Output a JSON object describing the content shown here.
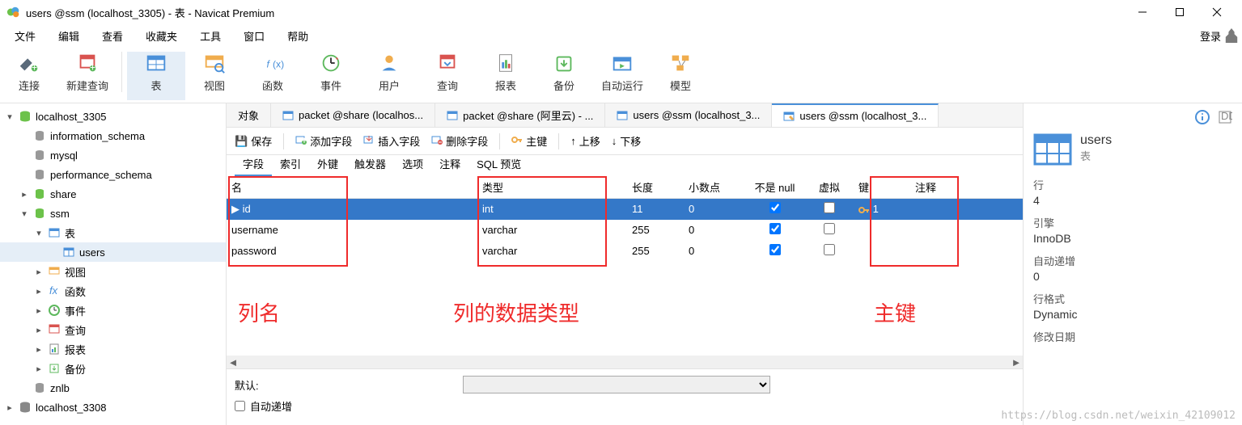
{
  "window": {
    "title": "users @ssm (localhost_3305) - 表 - Navicat Premium"
  },
  "menu": {
    "items": [
      "文件",
      "编辑",
      "查看",
      "收藏夹",
      "工具",
      "窗口",
      "帮助"
    ],
    "login": "登录"
  },
  "toolbar": {
    "connection": "连接",
    "new_query": "新建查询",
    "table": "表",
    "view": "视图",
    "function": "函数",
    "event": "事件",
    "user": "用户",
    "query": "查询",
    "report": "报表",
    "backup": "备份",
    "automation": "自动运行",
    "model": "模型"
  },
  "sidebar": {
    "items": [
      {
        "label": "localhost_3305",
        "type": "conn",
        "indent": 0,
        "expanded": true,
        "caret": true
      },
      {
        "label": "information_schema",
        "type": "db",
        "indent": 1,
        "caret": false
      },
      {
        "label": "mysql",
        "type": "db",
        "indent": 1,
        "caret": false
      },
      {
        "label": "performance_schema",
        "type": "db",
        "indent": 1,
        "caret": false
      },
      {
        "label": "share",
        "type": "db-open",
        "indent": 1,
        "caret": true,
        "expanded": false
      },
      {
        "label": "ssm",
        "type": "db-open",
        "indent": 1,
        "caret": true,
        "expanded": true
      },
      {
        "label": "表",
        "type": "folder-table",
        "indent": 2,
        "caret": true,
        "expanded": true
      },
      {
        "label": "users",
        "type": "table",
        "indent": 3,
        "caret": false,
        "selected": true
      },
      {
        "label": "视图",
        "type": "folder-view",
        "indent": 2,
        "caret": true
      },
      {
        "label": "函数",
        "type": "folder-fx",
        "indent": 2,
        "caret": true
      },
      {
        "label": "事件",
        "type": "folder-event",
        "indent": 2,
        "caret": true
      },
      {
        "label": "查询",
        "type": "folder-query",
        "indent": 2,
        "caret": true
      },
      {
        "label": "报表",
        "type": "folder-report",
        "indent": 2,
        "caret": true
      },
      {
        "label": "备份",
        "type": "folder-backup",
        "indent": 2,
        "caret": true
      },
      {
        "label": "znlb",
        "type": "db",
        "indent": 1,
        "caret": false
      },
      {
        "label": "localhost_3308",
        "type": "conn-off",
        "indent": 0,
        "caret": true
      }
    ]
  },
  "tabs": [
    {
      "label": "对象",
      "active": false,
      "icon": "none"
    },
    {
      "label": "packet @share (localhos...",
      "active": false,
      "icon": "table"
    },
    {
      "label": "packet @share (阿里云) - ...",
      "active": false,
      "icon": "table"
    },
    {
      "label": "users @ssm (localhost_3...",
      "active": false,
      "icon": "table"
    },
    {
      "label": "users @ssm (localhost_3...",
      "active": true,
      "icon": "design"
    }
  ],
  "subtoolbar": {
    "save": "保存",
    "add_field": "添加字段",
    "insert_field": "插入字段",
    "delete_field": "删除字段",
    "primary_key": "主键",
    "move_up": "上移",
    "move_down": "下移"
  },
  "subtabs": [
    "字段",
    "索引",
    "外键",
    "触发器",
    "选项",
    "注释",
    "SQL 预览"
  ],
  "grid": {
    "headers": {
      "name": "名",
      "type": "类型",
      "length": "长度",
      "decimals": "小数点",
      "notnull": "不是 null",
      "virtual": "虚拟",
      "key": "键",
      "comment": "注释"
    },
    "rows": [
      {
        "name": "id",
        "type": "int",
        "length": "11",
        "decimals": "0",
        "notnull": true,
        "virtual": false,
        "key": "1",
        "selected": true
      },
      {
        "name": "username",
        "type": "varchar",
        "length": "255",
        "decimals": "0",
        "notnull": true,
        "virtual": false,
        "key": ""
      },
      {
        "name": "password",
        "type": "varchar",
        "length": "255",
        "decimals": "0",
        "notnull": true,
        "virtual": false,
        "key": ""
      }
    ]
  },
  "annotations": {
    "col_name": "列名",
    "col_type": "列的数据类型",
    "primary_key": "主键"
  },
  "bottom": {
    "default_label": "默认:",
    "auto_increment": "自动递增"
  },
  "rightpanel": {
    "title": "users",
    "subtitle": "表",
    "rows_label": "行",
    "rows_value": "4",
    "engine_label": "引擎",
    "engine_value": "InnoDB",
    "autoinc_label": "自动递增",
    "autoinc_value": "0",
    "rowfmt_label": "行格式",
    "rowfmt_value": "Dynamic",
    "mod_label": "修改日期"
  },
  "watermark": "https://blog.csdn.net/weixin_42109012",
  "colors": {
    "accent": "#4a90d9",
    "red": "#ef2b2b",
    "sel": "#3478c8"
  }
}
